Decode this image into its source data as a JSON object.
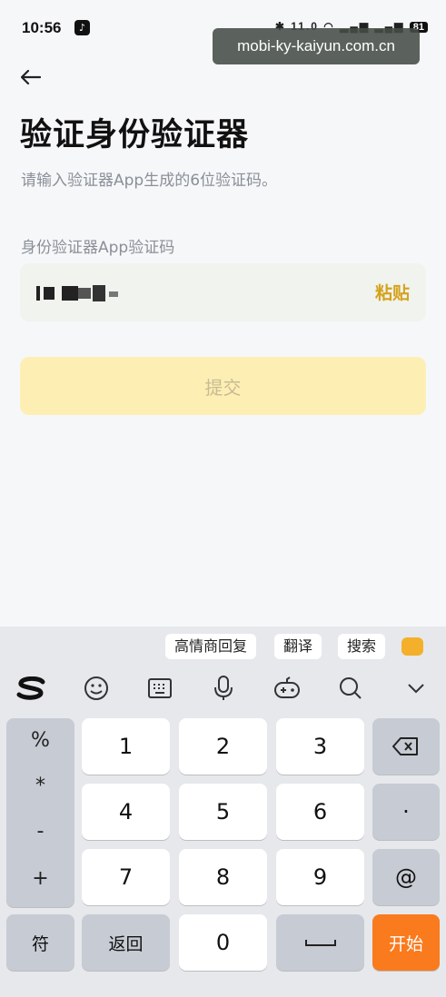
{
  "status_bar": {
    "time": "10:56",
    "app_icon": "tiktok-icon",
    "signal_text": "11.0",
    "battery": "81"
  },
  "watermark": "mobi-ky-kaiyun.com.cn",
  "header": {
    "back_icon": "arrow-left-icon",
    "title": "验证身份验证器",
    "subtitle": "请输入验证器App生成的6位验证码。"
  },
  "form": {
    "code_label": "身份验证器App验证码",
    "paste_label": "粘贴",
    "submit_label": "提交",
    "colors": {
      "paste": "#d6a21c",
      "submit_bg": "#fdefb4",
      "submit_text": "#c8bb93"
    }
  },
  "keyboard": {
    "suggestions": [
      "高情商回复",
      "翻译",
      "搜索"
    ],
    "tools": [
      "sogou-logo-icon",
      "emoji-icon",
      "keyboard-icon",
      "microphone-icon",
      "gamepad-icon",
      "search-icon",
      "chevron-down-icon"
    ],
    "symbols": [
      "%",
      "*",
      "-",
      "+"
    ],
    "digits": [
      "1",
      "2",
      "3",
      "4",
      "5",
      "6",
      "7",
      "8",
      "9",
      "0"
    ],
    "dot": "·",
    "at": "@",
    "fu": "符",
    "back_label": "返回",
    "enter_label": "开始",
    "colors": {
      "enter": "#fa7a1e",
      "function_key": "#c7cbd3"
    }
  }
}
